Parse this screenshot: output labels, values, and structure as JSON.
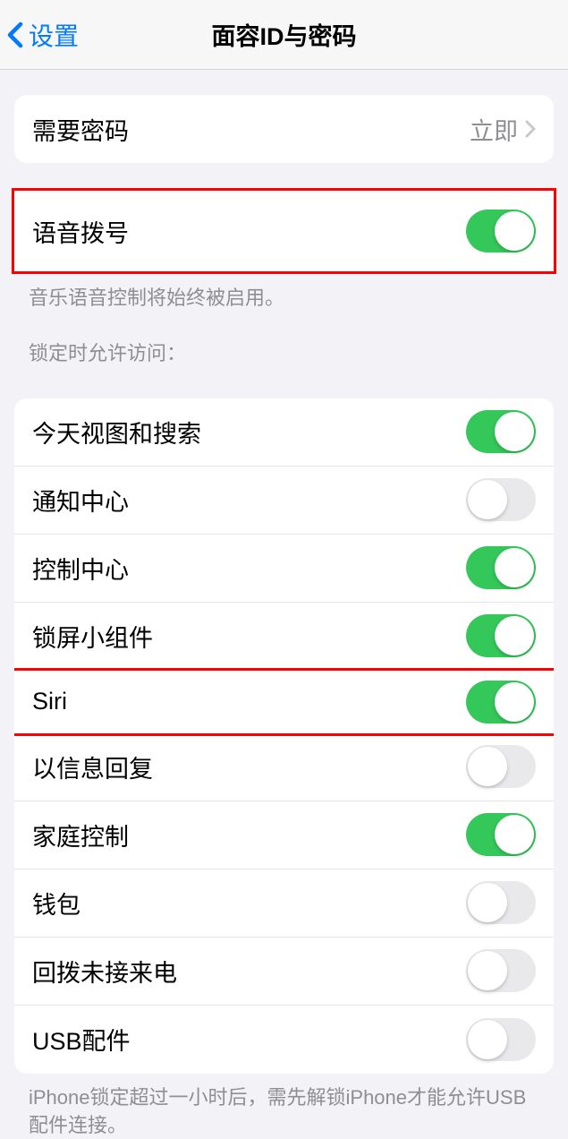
{
  "header": {
    "back_label": "设置",
    "title": "面容ID与密码"
  },
  "require_passcode": {
    "label": "需要密码",
    "value": "立即"
  },
  "voice_dial": {
    "label": "语音拨号",
    "enabled": true,
    "footer": "音乐语音控制将始终被启用。"
  },
  "allow_access_header": "锁定时允许访问：",
  "allow_access": [
    {
      "label": "今天视图和搜索",
      "enabled": true,
      "highlighted": false
    },
    {
      "label": "通知中心",
      "enabled": false,
      "highlighted": false
    },
    {
      "label": "控制中心",
      "enabled": true,
      "highlighted": false
    },
    {
      "label": "锁屏小组件",
      "enabled": true,
      "highlighted": false
    },
    {
      "label": "Siri",
      "enabled": true,
      "highlighted": true
    },
    {
      "label": "以信息回复",
      "enabled": false,
      "highlighted": false
    },
    {
      "label": "家庭控制",
      "enabled": true,
      "highlighted": false
    },
    {
      "label": "钱包",
      "enabled": false,
      "highlighted": false
    },
    {
      "label": "回拨未接来电",
      "enabled": false,
      "highlighted": false
    },
    {
      "label": "USB配件",
      "enabled": false,
      "highlighted": false
    }
  ],
  "usb_footer": "iPhone锁定超过一小时后，需先解锁iPhone才能允许USB配件连接。"
}
